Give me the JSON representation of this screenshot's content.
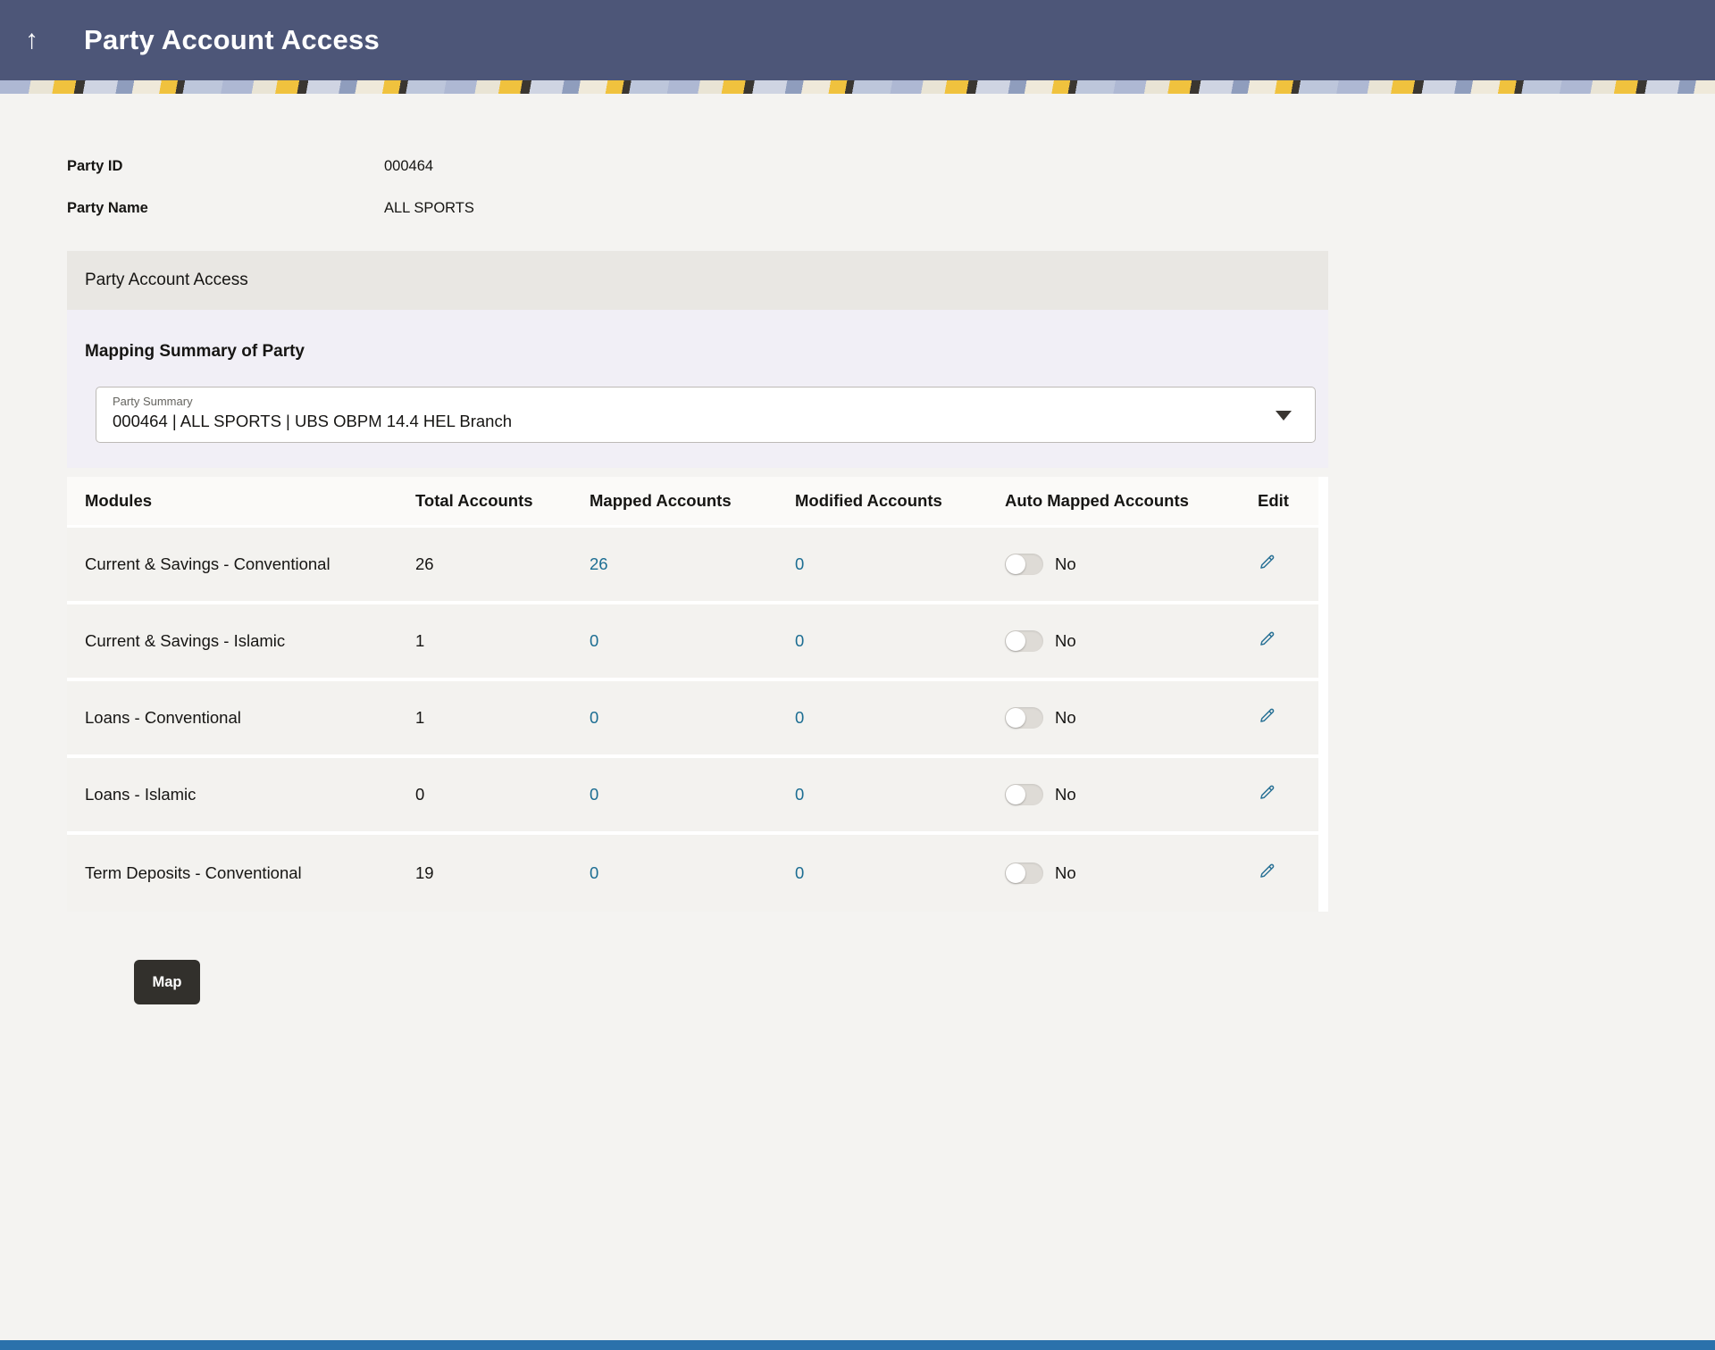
{
  "header": {
    "title": "Party Account Access",
    "back_icon_glyph": "↑"
  },
  "party_info": {
    "id_label": "Party ID",
    "id_value": "000464",
    "name_label": "Party Name",
    "name_value": "ALL SPORTS"
  },
  "panel": {
    "title": "Party Account Access",
    "mapping_title": "Mapping Summary of Party",
    "party_summary": {
      "label": "Party Summary",
      "value": "000464 | ALL SPORTS | UBS OBPM 14.4 HEL Branch"
    }
  },
  "table": {
    "columns": [
      "Modules",
      "Total Accounts",
      "Mapped Accounts",
      "Modified Accounts",
      "Auto Mapped Accounts",
      "Edit"
    ],
    "rows": [
      {
        "module": "Current & Savings - Conventional",
        "total": "26",
        "mapped": "26",
        "modified": "0",
        "auto_mapped": "No"
      },
      {
        "module": "Current & Savings - Islamic",
        "total": "1",
        "mapped": "0",
        "modified": "0",
        "auto_mapped": "No"
      },
      {
        "module": "Loans - Conventional",
        "total": "1",
        "mapped": "0",
        "modified": "0",
        "auto_mapped": "No"
      },
      {
        "module": "Loans - Islamic",
        "total": "0",
        "mapped": "0",
        "modified": "0",
        "auto_mapped": "No"
      },
      {
        "module": "Term Deposits - Conventional",
        "total": "19",
        "mapped": "0",
        "modified": "0",
        "auto_mapped": "No"
      }
    ]
  },
  "actions": {
    "map_label": "Map"
  },
  "colors": {
    "header_bg": "#4d5678",
    "link_blue": "#1b6d92",
    "page_bg": "#f4f3f1",
    "lavender_bg": "#f1eff6",
    "button_bg": "#32302c",
    "footer_blue": "#2b71ab"
  }
}
